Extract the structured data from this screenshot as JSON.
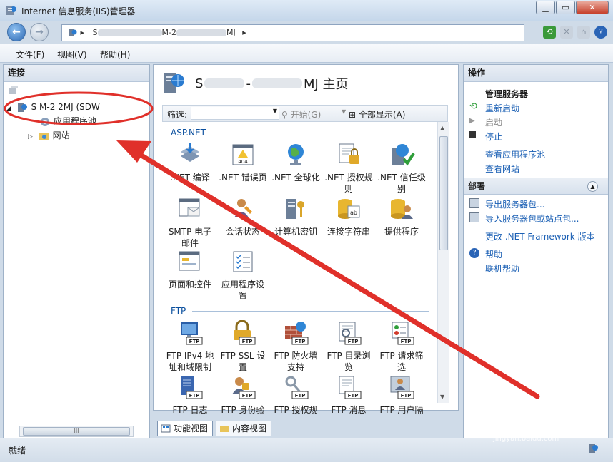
{
  "window": {
    "title": "Internet 信息服务(IIS)管理器"
  },
  "address": {
    "sep1": "▸",
    "part1": "S",
    "part2": "M-2",
    "part3": "MJ",
    "sep2": "▸"
  },
  "menu": {
    "file": "文件(F)",
    "view": "视图(V)",
    "help": "帮助(H)"
  },
  "left_panel": {
    "header": "连接",
    "tree": [
      {
        "label": "S      M-2      2MJ (SDW",
        "expander": "◢"
      },
      {
        "label": "应用程序池"
      },
      {
        "label": "网站",
        "expander": "▷"
      }
    ],
    "scroll_label": "III"
  },
  "center": {
    "title_a": "S",
    "title_b": "-",
    "title_c": "MJ 主页",
    "filter_label": "筛选:",
    "go_label": "开始(G)",
    "showall_label": "全部显示(A)",
    "sections": [
      {
        "name": "ASP.NET",
        "items": [
          {
            "line1": ".NET 编译",
            "line2": ""
          },
          {
            "line1": ".NET 错误页",
            "line2": ""
          },
          {
            "line1": ".NET 全球化",
            "line2": ""
          },
          {
            "line1": ".NET 授权规",
            "line2": "则"
          },
          {
            "line1": ".NET 信任级",
            "line2": "别"
          },
          {
            "line1": "SMTP 电子",
            "line2": "邮件"
          },
          {
            "line1": "会话状态",
            "line2": ""
          },
          {
            "line1": "计算机密钥",
            "line2": ""
          },
          {
            "line1": "连接字符串",
            "line2": ""
          },
          {
            "line1": "提供程序",
            "line2": ""
          },
          {
            "line1": "页面和控件",
            "line2": ""
          },
          {
            "line1": "应用程序设",
            "line2": "置"
          }
        ]
      },
      {
        "name": "FTP",
        "items": [
          {
            "line1": "FTP IPv4 地",
            "line2": "址和域限制"
          },
          {
            "line1": "FTP SSL 设",
            "line2": "置"
          },
          {
            "line1": "FTP 防火墙",
            "line2": "支持"
          },
          {
            "line1": "FTP 目录浏",
            "line2": "览"
          },
          {
            "line1": "FTP 请求筛",
            "line2": "选"
          },
          {
            "line1": "FTP 日志",
            "line2": ""
          },
          {
            "line1": "FTP 身份验",
            "line2": ""
          },
          {
            "line1": "FTP 授权规",
            "line2": ""
          },
          {
            "line1": "FTP 消息",
            "line2": ""
          },
          {
            "line1": "FTP 用户隔",
            "line2": ""
          }
        ]
      }
    ],
    "icon_text": {
      "err404": "404",
      "ftp": "FTP",
      "ab": "ab"
    },
    "view_tabs": {
      "features": "功能视图",
      "content": "内容视图"
    }
  },
  "right_panel": {
    "header": "操作",
    "manage_header": "管理服务器",
    "restart": "重新启动",
    "start": "启动",
    "stop": "停止",
    "view_pools": "查看应用程序池",
    "view_sites": "查看网站",
    "deploy_header": "部署",
    "export": "导出服务器包...",
    "import": "导入服务器包或站点包...",
    "netfx": "更改 .NET Framework 版本",
    "help": "帮助",
    "online_help": "联机帮助"
  },
  "status": {
    "text": "就绪"
  },
  "watermark": {
    "main": "Baidu 经验",
    "sub": "jingyan.baidu.com"
  },
  "colors": {
    "annotation": "#e0302a",
    "link": "#1a5fb4"
  }
}
